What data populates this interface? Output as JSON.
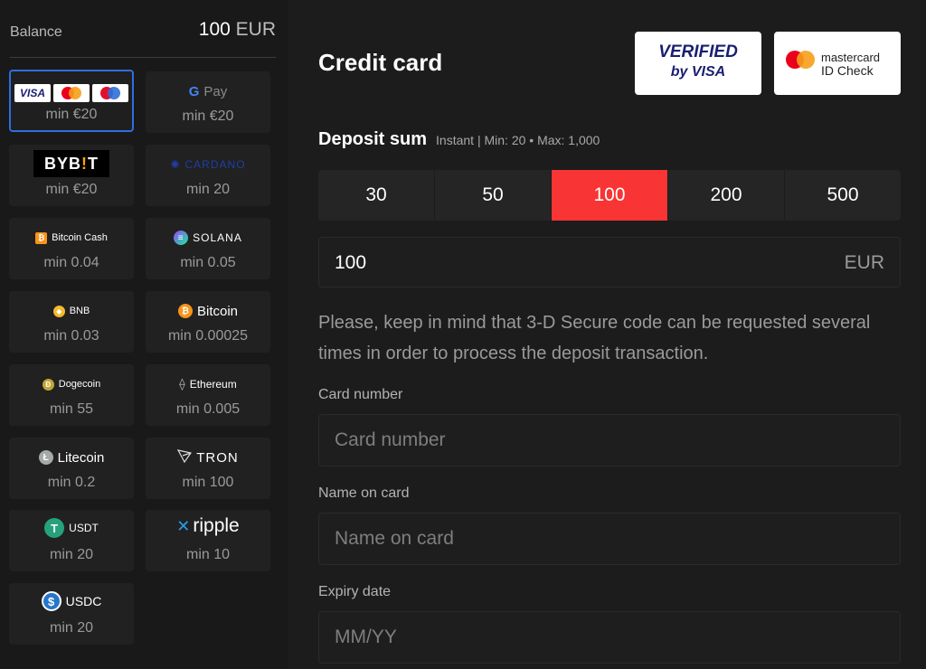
{
  "balance": {
    "label": "Balance",
    "amount": "100",
    "currency": "EUR"
  },
  "methods": [
    {
      "name": "Visa / Mastercard / Maestro",
      "min": "min €20"
    },
    {
      "name": "G Pay",
      "min": "min €20"
    },
    {
      "name": "BYBIT",
      "min": "min €20"
    },
    {
      "name": "CARDANO",
      "min": "min 20"
    },
    {
      "name": "Bitcoin Cash",
      "min": "min 0.04"
    },
    {
      "name": "SOLANA",
      "min": "min 0.05"
    },
    {
      "name": "BNB",
      "min": "min 0.03"
    },
    {
      "name": "Bitcoin",
      "min": "min 0.00025"
    },
    {
      "name": "Dogecoin",
      "min": "min 55"
    },
    {
      "name": "Ethereum",
      "min": "min 0.005"
    },
    {
      "name": "Litecoin",
      "min": "min 0.2"
    },
    {
      "name": "TRON",
      "min": "min 100"
    },
    {
      "name": "USDT",
      "min": "min 20"
    },
    {
      "name": "ripple",
      "min": "min 10"
    },
    {
      "name": "USDC",
      "min": "min 20"
    }
  ],
  "logos": {
    "visa": "VISA",
    "gpay_g": "G",
    "gpay_text": "Pay",
    "bybit_a": "BYB",
    "bybit_b": "!",
    "bybit_c": "T"
  },
  "main": {
    "title": "Credit card",
    "verified_line1": "VERIFIED",
    "verified_line2": "by VISA",
    "mc_line1": "mastercard",
    "mc_line2": "ID Check",
    "deposit_label": "Deposit sum",
    "deposit_info": "Instant | Min: 20 • Max: 1,000",
    "amounts": [
      "30",
      "50",
      "100",
      "200",
      "500"
    ],
    "selected_amount": "100",
    "sum_value": "100",
    "sum_currency": "EUR",
    "notice": "Please, keep in mind that 3-D Secure code can be requested several times in order to process the deposit transaction.",
    "card_number_label": "Card number",
    "card_number_placeholder": "Card number",
    "name_label": "Name on card",
    "name_placeholder": "Name on card",
    "expiry_label": "Expiry date",
    "expiry_placeholder": "MM/YY"
  },
  "colors": {
    "accent": "#f93434",
    "selected_border": "#2f6de1"
  }
}
